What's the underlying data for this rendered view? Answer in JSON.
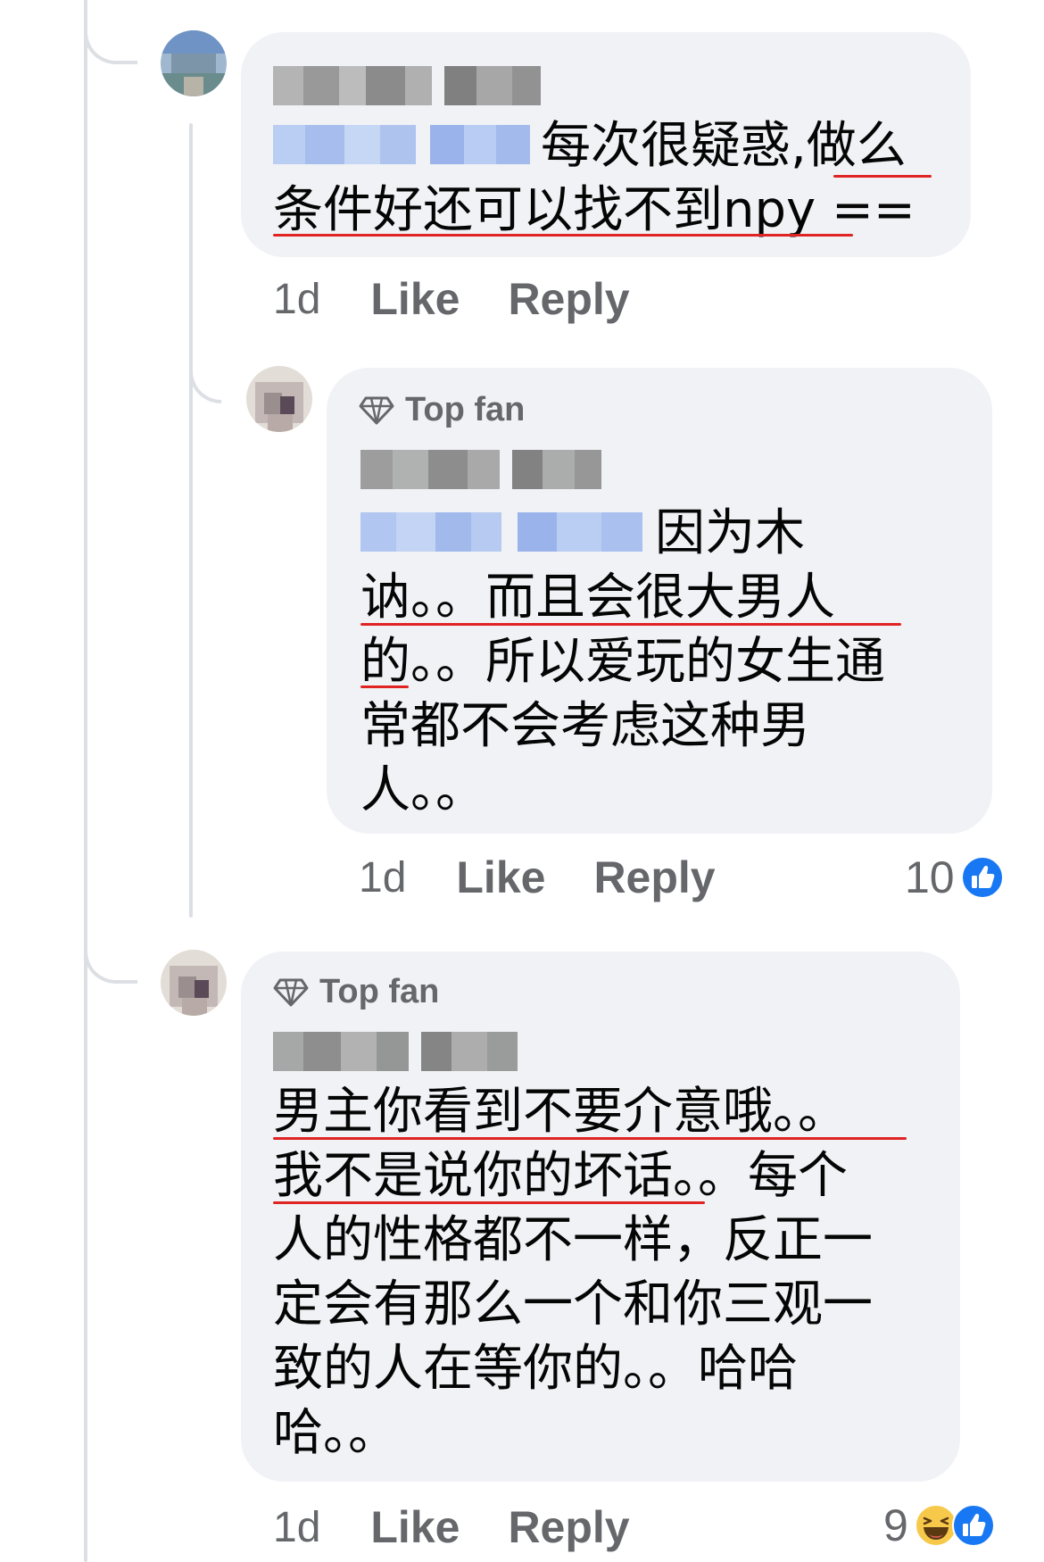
{
  "comments": [
    {
      "author_badge": "",
      "text_lines": [
        "每次很疑惑,做么",
        "条件好还可以找不到npy =="
      ],
      "time": "1d",
      "like_label": "Like",
      "reply_label": "Reply",
      "reaction_count": "",
      "reactions": []
    },
    {
      "author_badge": "Top fan",
      "text_lines": [
        "因为木",
        "讷。。而且会很大男人",
        "的。。所以爱玩的女生通",
        "常都不会考虑这种男",
        "人。。"
      ],
      "time": "1d",
      "like_label": "Like",
      "reply_label": "Reply",
      "reaction_count": "10",
      "reactions": [
        "like-icon"
      ]
    },
    {
      "author_badge": "Top fan",
      "text_lines": [
        "男主你看到不要介意哦。。",
        "我不是说你的坏话。。每个",
        "人的性格都不一样，反正一",
        "定会有那么一个和你三观一",
        "致的人在等你的。。哈哈",
        "哈。。"
      ],
      "time": "1d",
      "like_label": "Like",
      "reply_label": "Reply",
      "reaction_count": "9",
      "reactions": [
        "haha-icon",
        "like-icon"
      ]
    }
  ],
  "colors": {
    "bubble": "#f0f2f5",
    "muted_text": "#65676b",
    "like_blue": "#1877f2",
    "underline_red": "#e02424",
    "haha_yellow": "#f7c94b"
  }
}
